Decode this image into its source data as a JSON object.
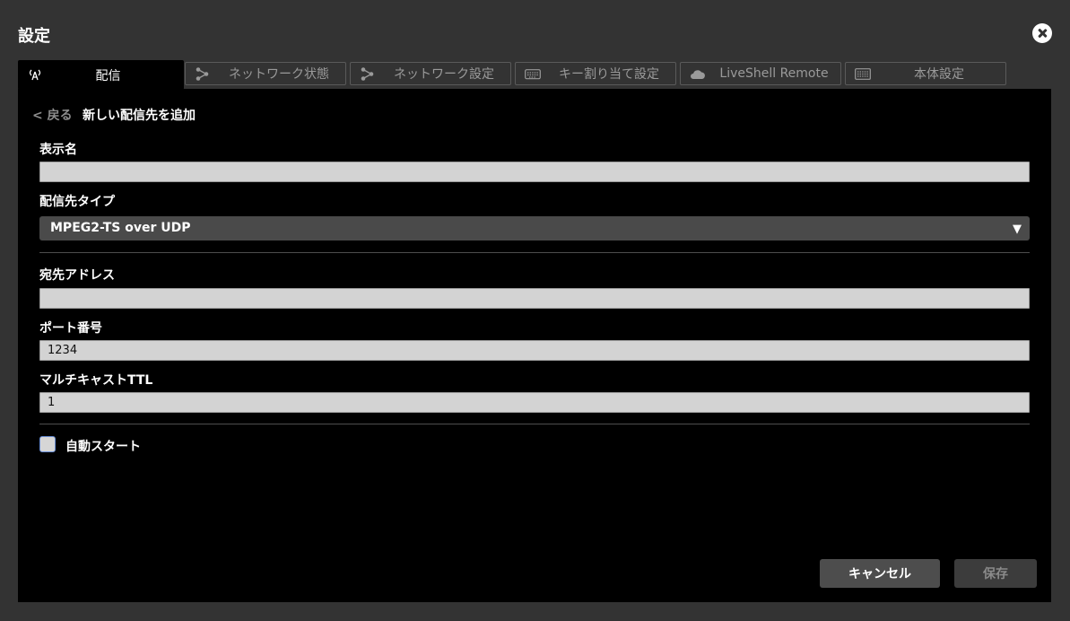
{
  "dialog": {
    "title": "設定"
  },
  "tabs": [
    {
      "label": "配信",
      "icon": "broadcast-icon",
      "active": true
    },
    {
      "label": "ネットワーク状態",
      "icon": "share-icon",
      "active": false
    },
    {
      "label": "ネットワーク設定",
      "icon": "share-icon",
      "active": false
    },
    {
      "label": "キー割り当て設定",
      "icon": "keyboard-icon",
      "active": false
    },
    {
      "label": "LiveShell Remote",
      "icon": "cloud-icon",
      "active": false
    },
    {
      "label": "本体設定",
      "icon": "device-icon",
      "active": false
    }
  ],
  "panel": {
    "back_label": "< 戻る",
    "section_title": "新しい配信先を追加",
    "display_name": {
      "label": "表示名",
      "value": ""
    },
    "dest_type": {
      "label": "配信先タイプ",
      "selected": "MPEG2-TS over UDP"
    },
    "dest_address": {
      "label": "宛先アドレス",
      "value": ""
    },
    "port": {
      "label": "ポート番号",
      "value": "1234"
    },
    "multicast_ttl": {
      "label": "マルチキャストTTL",
      "value": "1"
    },
    "auto_start": {
      "label": "自動スタート",
      "checked": false
    }
  },
  "footer": {
    "cancel_label": "キャンセル",
    "save_label": "保存"
  },
  "colors": {
    "background": "#333333",
    "panel": "#000000",
    "field": "#d3d3d3",
    "select": "#4a4a4a",
    "checkbox_border": "#6a8fd6"
  }
}
